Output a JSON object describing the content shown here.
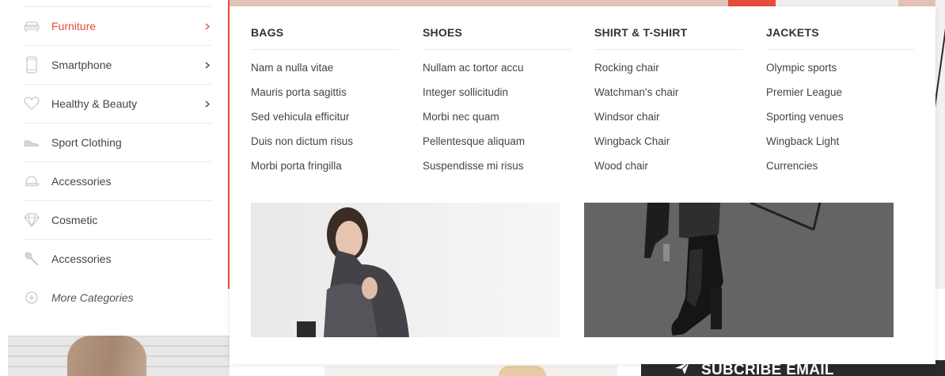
{
  "sidebar": {
    "items": [
      {
        "label": "Furniture",
        "icon": "sofa-icon",
        "active": true,
        "has_submenu": true
      },
      {
        "label": "Smartphone",
        "icon": "smartphone-icon",
        "active": false,
        "has_submenu": true
      },
      {
        "label": "Healthy & Beauty",
        "icon": "heart-icon",
        "active": false,
        "has_submenu": true
      },
      {
        "label": "Sport Clothing",
        "icon": "sneaker-icon",
        "active": false,
        "has_submenu": false
      },
      {
        "label": "Accessories",
        "icon": "cap-icon",
        "active": false,
        "has_submenu": false
      },
      {
        "label": "Cosmetic",
        "icon": "diamond-icon",
        "active": false,
        "has_submenu": false
      },
      {
        "label": "Accessories",
        "icon": "brush-icon",
        "active": false,
        "has_submenu": false
      }
    ],
    "more_label": "More Categories",
    "more_icon": "plus-circle-icon"
  },
  "mega_menu": {
    "columns": [
      {
        "title": "BAGS",
        "links": [
          "Nam a nulla vitae",
          "Mauris porta sagittis",
          "Sed vehicula efficitur",
          "Duis non dictum risus",
          "Morbi porta fringilla"
        ]
      },
      {
        "title": "SHOES",
        "links": [
          "Nullam ac tortor accu",
          "Integer sollicitudin",
          "Morbi nec quam",
          "Pellentesque aliquam",
          "Suspendisse mi risus"
        ]
      },
      {
        "title": "SHIRT & T-SHIRT",
        "links": [
          "Rocking chair",
          "Watchman's chair",
          "Windsor chair",
          "Wingback Chair",
          "Wood chair"
        ]
      },
      {
        "title": "JACKETS",
        "links": [
          "Olympic sports",
          "Premier League",
          "Sporting venues",
          "Wingback Light",
          "Currencies"
        ]
      }
    ]
  },
  "subscribe": {
    "label": "SUBCRIBE EMAIL",
    "icon": "paper-plane-icon"
  },
  "colors": {
    "accent": "#e74c3c",
    "banner": "#e3c3b9",
    "text": "#444444",
    "divider": "#ececec"
  }
}
